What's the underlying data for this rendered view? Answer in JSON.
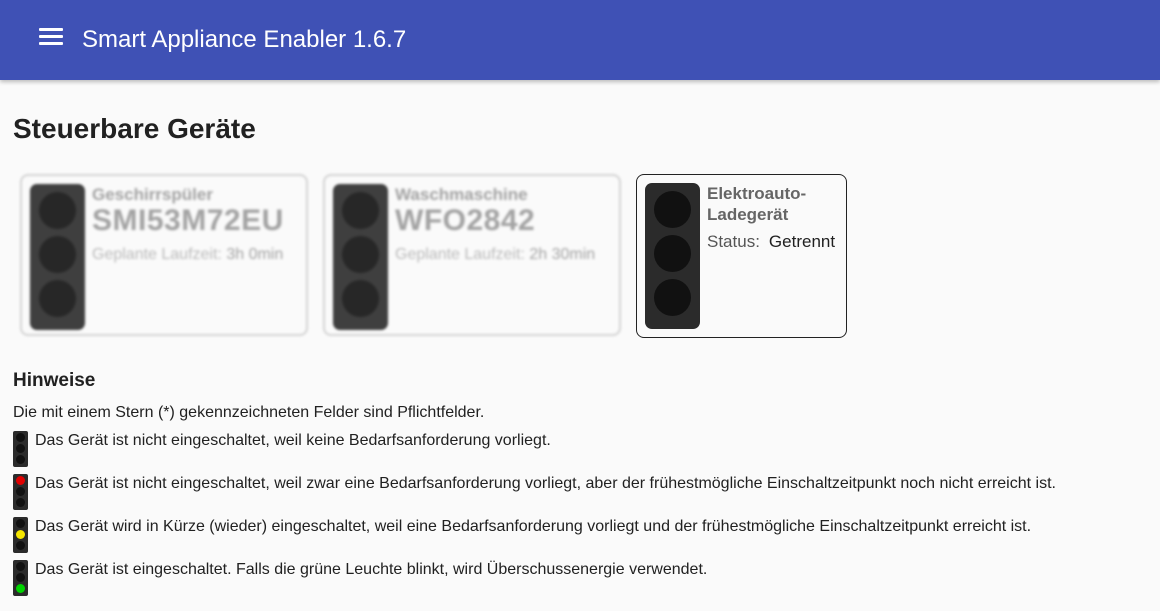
{
  "app": {
    "title": "Smart Appliance Enabler 1.6.7",
    "menu_icon": "hamburger-menu-icon",
    "header_color": "#3f51b5"
  },
  "page": {
    "title": "Steuerbare Geräte"
  },
  "devices": [
    {
      "type": "Geschirrspüler",
      "model": "SMI53M72EU",
      "runtime_label": "Geplante Laufzeit:",
      "runtime_value": "3h 0min",
      "state": "blurred",
      "light": "off"
    },
    {
      "type": "Waschmaschine",
      "model": "WFO2842",
      "runtime_label": "Geplante Laufzeit:",
      "runtime_value": "2h 30min",
      "state": "blurred",
      "light": "off"
    },
    {
      "type": "Elektroauto-Ladegerät",
      "type_line1": "Elektroauto-",
      "type_line2": "Ladegerät",
      "status_label": "Status:",
      "status_value": "Getrennt",
      "state": "active",
      "light": "off"
    }
  ],
  "hints": {
    "title": "Hinweise",
    "required_note": "Die mit einem Stern (*) gekennzeichneten Felder sind Pflichtfelder.",
    "items": [
      {
        "light": "none",
        "text": "Das Gerät ist nicht eingeschaltet, weil keine Bedarfsanforderung vorliegt."
      },
      {
        "light": "red",
        "text": "Das Gerät ist nicht eingeschaltet, weil zwar eine Bedarfsanforderung vorliegt, aber der frühestmögliche Einschaltzeitpunkt noch nicht erreicht ist."
      },
      {
        "light": "yellow",
        "text": "Das Gerät wird in Kürze (wieder) eingeschaltet, weil eine Bedarfsanforderung vorliegt und der frühestmögliche Einschaltzeitpunkt erreicht ist."
      },
      {
        "light": "green",
        "text": "Das Gerät ist eingeschaltet. Falls die grüne Leuchte blinkt, wird Überschussenergie verwendet."
      }
    ]
  },
  "colors": {
    "lamp_off": "#111111",
    "lamp_red": "#e00000",
    "lamp_yellow": "#f5e600",
    "lamp_green": "#00d400",
    "traffic_light_body": "#2b2b2b"
  }
}
